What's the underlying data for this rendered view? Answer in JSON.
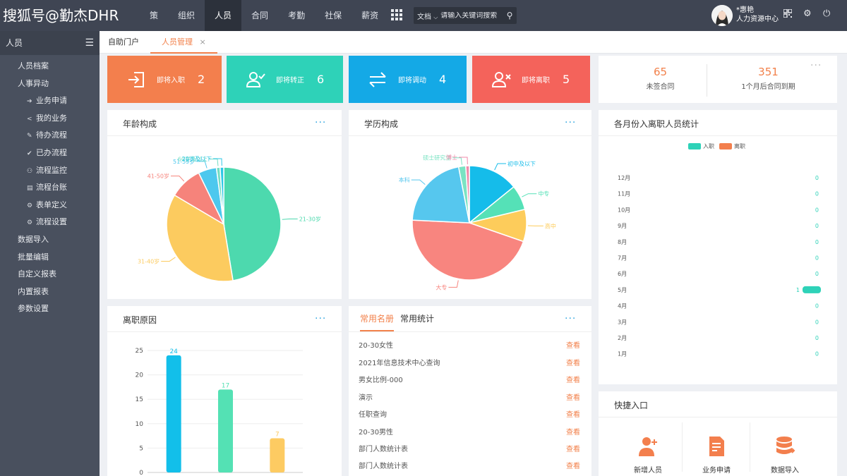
{
  "watermark": "搜狐号@勤杰DHR",
  "nav": [
    "策",
    "组织",
    "人员",
    "合同",
    "考勤",
    "社保",
    "薪资"
  ],
  "search": {
    "doc_label": "文档",
    "placeholder": "请输入关键词搜索"
  },
  "user": {
    "name": "*惠艳",
    "role": "人力资源中心"
  },
  "sidebar": {
    "title": "人员",
    "items": [
      {
        "label": "人员档案"
      },
      {
        "label": "人事异动"
      }
    ],
    "subitems": [
      {
        "label": "业务申请",
        "icon": "arrow-right-icon"
      },
      {
        "label": "我的业务",
        "icon": "share-icon"
      },
      {
        "label": "待办流程",
        "icon": "pencil-icon"
      },
      {
        "label": "已办流程",
        "icon": "check-icon"
      },
      {
        "label": "流程监控",
        "icon": "binoculars-icon"
      },
      {
        "label": "流程台账",
        "icon": "ledger-icon"
      },
      {
        "label": "表单定义",
        "icon": "gear-icon"
      },
      {
        "label": "流程设置",
        "icon": "gear-icon"
      }
    ],
    "items2": [
      {
        "label": "数据导入"
      },
      {
        "label": "批量编辑"
      },
      {
        "label": "自定义报表"
      },
      {
        "label": "内置报表"
      },
      {
        "label": "参数设置"
      }
    ]
  },
  "tabs": [
    {
      "label": "自助门户"
    },
    {
      "label": "人员管理"
    }
  ],
  "tab_close": "×",
  "stats": [
    {
      "label": "即将入职",
      "value": "2",
      "color": "#f37f4d"
    },
    {
      "label": "即将转正",
      "value": "6",
      "color": "#2ed2b8"
    },
    {
      "label": "即将调动",
      "value": "4",
      "color": "#14a9e6"
    },
    {
      "label": "即将离职",
      "value": "5",
      "color": "#f4635b"
    }
  ],
  "contract": [
    {
      "value": "65",
      "label": "未签合同"
    },
    {
      "value": "351",
      "label": "1个月后合同到期"
    }
  ],
  "more": "···",
  "age_chart": {
    "title": "年龄构成"
  },
  "edu_chart": {
    "title": "学历构成"
  },
  "monthly": {
    "title": "各月份入离职人员统计",
    "legend": [
      "入职",
      "离职"
    ]
  },
  "reason": {
    "title": "离职原因"
  },
  "list": {
    "tabs": [
      "常用名册",
      "常用统计"
    ],
    "view_label": "查看",
    "rows": [
      "20-30女性",
      "2021年信息技术中心查询",
      "男女比例-000",
      "演示",
      "任职查询",
      "20-30男性",
      "部门人数统计表",
      "部门人数统计表"
    ]
  },
  "quick": {
    "title": "快捷入口",
    "items": [
      "新增人员",
      "业务申请",
      "数据导入"
    ]
  },
  "chart_data": [
    {
      "type": "pie",
      "title": "年龄构成",
      "labels": [
        "21-30岁",
        "31-40岁",
        "41-50岁",
        "51-59岁",
        "60岁及以上",
        "20岁及以下"
      ],
      "values": [
        46,
        35,
        9,
        5,
        1,
        1
      ],
      "colors": [
        "#4dd9ae",
        "#fccb5f",
        "#f6837b",
        "#4dc8ee",
        "#72ddc2",
        "#2ec7e6"
      ]
    },
    {
      "type": "pie",
      "title": "学历构成",
      "labels": [
        "初中及以下",
        "中专",
        "高中",
        "大专",
        "本科",
        "硕士研究生",
        "博士"
      ],
      "values": [
        14,
        7,
        9,
        45,
        21,
        2,
        1
      ],
      "colors": [
        "#15bcea",
        "#55e1b7",
        "#fdcc5b",
        "#f8857f",
        "#56c7ee",
        "#7ae3c3",
        "#f08aaa"
      ]
    },
    {
      "type": "bar",
      "title": "离职原因",
      "values": [
        24,
        17,
        7
      ],
      "colors": [
        "#12bfea",
        "#54e1b4",
        "#fdcb62"
      ],
      "ylim": [
        0,
        25
      ],
      "yticks": [
        0,
        5,
        10,
        15,
        20,
        25
      ]
    },
    {
      "type": "bar",
      "title": "各月份入离职人员统计",
      "categories": [
        "12月",
        "11月",
        "10月",
        "9月",
        "8月",
        "7月",
        "6月",
        "5月",
        "4月",
        "3月",
        "2月",
        "1月"
      ],
      "series": [
        {
          "name": "入职",
          "values": [
            0,
            0,
            0,
            0,
            0,
            0,
            0,
            1,
            0,
            0,
            0,
            0
          ],
          "color": "#2ed2b8"
        },
        {
          "name": "离职",
          "values": [
            0,
            0,
            0,
            0,
            0,
            0,
            0,
            0,
            0,
            0,
            0,
            0
          ],
          "color": "#f37f4d"
        }
      ]
    }
  ]
}
